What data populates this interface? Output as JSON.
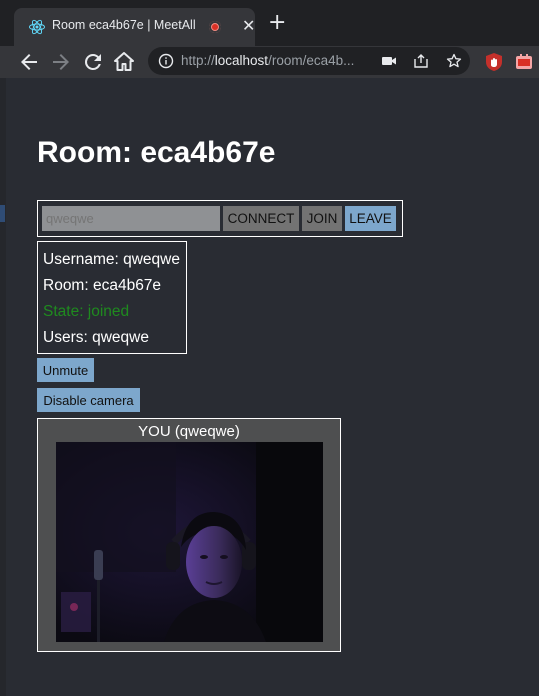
{
  "browser": {
    "tab_title": "Room eca4b67e | MeetAll",
    "tab_close": "✕",
    "new_tab": "+",
    "url_scheme": "http://",
    "url_host": "localhost",
    "url_path": "/room/eca4b...",
    "icons": {
      "favicon": "react-icon",
      "recording": "recording-dot-icon",
      "lock": "not-secure-info-icon",
      "camera": "camera-icon",
      "share": "share-icon",
      "bookmark": "star-icon",
      "extension1": "ublock-icon",
      "extension2": "ext-icon"
    }
  },
  "page": {
    "title": "Room: eca4b67e",
    "username_input": {
      "value": "",
      "placeholder": "qweqwe"
    },
    "buttons": {
      "connect": "CONNECT",
      "join": "JOIN",
      "leave": "LEAVE",
      "unmute": "Unmute",
      "disable_camera": "Disable camera"
    },
    "info": {
      "username": "Username: qweqwe",
      "room": "Room: eca4b67e",
      "state": "State: joined",
      "users": "Users: qweqwe"
    },
    "video": {
      "label": "YOU (qweqwe)"
    }
  },
  "colors": {
    "background": "#292c33",
    "state_joined": "#1f8a1f",
    "button_active": "#7da7cc",
    "button_inactive": "#737373"
  }
}
